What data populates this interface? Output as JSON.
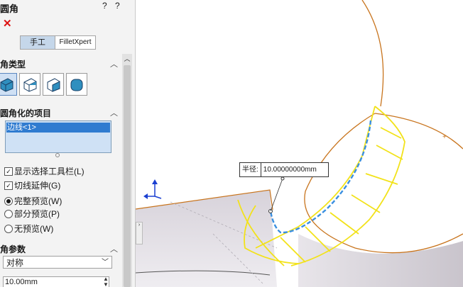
{
  "panel": {
    "title": "圆角",
    "help_icons": "?  ?",
    "close_symbol": "✕",
    "tabs": {
      "manual": "手工",
      "filletxpert": "FilletXpert"
    },
    "section_type": {
      "title": "角类型"
    },
    "section_items": {
      "title": "圆角化的项目",
      "list_items": [
        "边线<1>"
      ]
    },
    "options": {
      "show_toolbar": "显示选择工具栏(L)",
      "tangent_propagation": "切线延伸(G)",
      "full_preview": "完整预览(W)",
      "partial_preview": "部分预览(P)",
      "no_preview": "无预览(W)"
    },
    "section_params": {
      "title": "角参数",
      "method": "对称",
      "radius_value": "10.00mm"
    }
  },
  "viewport": {
    "callout": {
      "label": "半径:",
      "value": "10.00000000mm"
    }
  }
}
